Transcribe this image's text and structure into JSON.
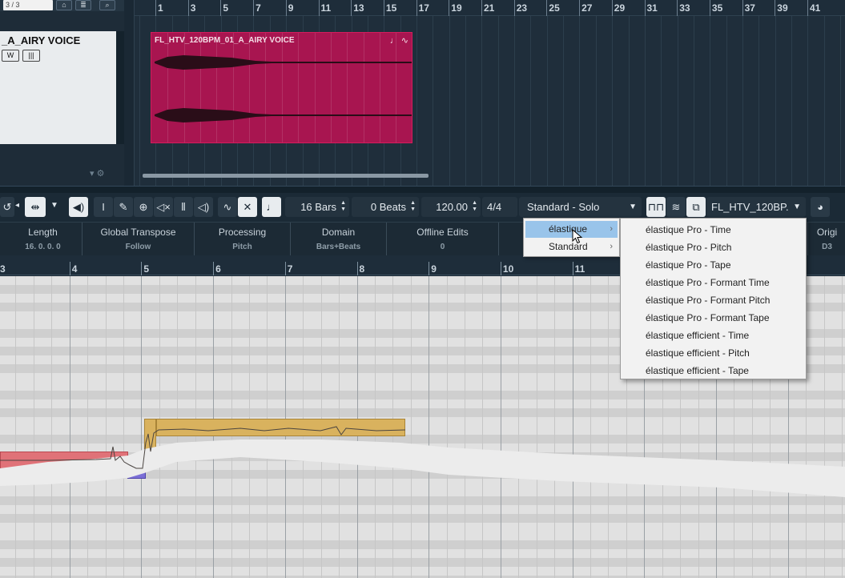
{
  "top": {
    "track_counter": "3 / 3",
    "track_name": "_A_AIRY VOICE",
    "track_buttons": [
      "W",
      "|||"
    ],
    "ruler": [
      "1",
      "3",
      "5",
      "7",
      "9",
      "11",
      "13",
      "15",
      "17",
      "19",
      "21",
      "23",
      "25",
      "27",
      "29",
      "31",
      "33",
      "35",
      "37",
      "39",
      "41"
    ],
    "event_name": "FL_HTV_120BPM_01_A_AIRY VOICE",
    "event_icons": "♩ ∿"
  },
  "toolbar": {
    "bars": "16 Bars",
    "beats": "0 Beats",
    "tempo": "120.00",
    "time_signature": "4/4",
    "algorithm": "Standard - Solo",
    "file": "FL_HTV_120BP."
  },
  "info_line": [
    {
      "label": "Length",
      "value": "16. 0. 0. 0"
    },
    {
      "label": "Global Transpose",
      "value": "Follow"
    },
    {
      "label": "Processing",
      "value": "Pitch"
    },
    {
      "label": "Domain",
      "value": "Bars+Beats"
    },
    {
      "label": "Offline Edits",
      "value": "0"
    },
    {
      "label": "Origi",
      "value": "D3"
    }
  ],
  "editor_ruler": [
    "3",
    "4",
    "5",
    "6",
    "7",
    "8",
    "9",
    "10",
    "11"
  ],
  "menu": {
    "items": [
      "élastique",
      "Standard"
    ],
    "submenu": [
      "élastique Pro - Time",
      "élastique Pro - Pitch",
      "élastique Pro - Tape",
      "élastique Pro - Formant Time",
      "élastique Pro - Formant Pitch",
      "élastique Pro - Formant Tape",
      "élastique efficient - Time",
      "élastique efficient - Pitch",
      "élastique efficient - Tape"
    ]
  },
  "colors": {
    "event": "#a81550",
    "menu_highlight": "#99c4ea",
    "pitch_red": "#e07278",
    "pitch_purple": "#7b6fd6",
    "pitch_gold": "#d9b25e"
  }
}
